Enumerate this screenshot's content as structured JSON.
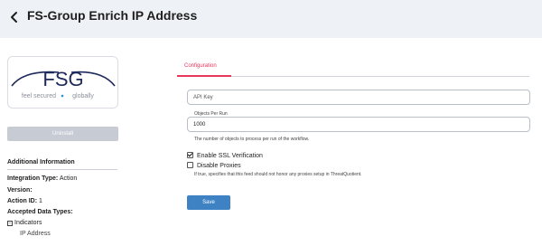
{
  "header": {
    "title": "FS-Group Enrich IP Address",
    "back_icon": "chevron-left-icon"
  },
  "sidebar": {
    "logo": {
      "mark": "FSG",
      "tagline_left": "feel secured",
      "tagline_right": "globally",
      "brand_color": "#1f2a5c",
      "dot_color": "#2a8fd6"
    },
    "uninstall_label": "Uninstall",
    "additional_info": {
      "heading": "Additional Information",
      "integration_type_label": "Integration Type:",
      "integration_type_value": "Action",
      "version_label": "Version:",
      "version_value": "",
      "action_id_label": "Action ID:",
      "action_id_value": "1",
      "accepted_types_label": "Accepted Data Types:",
      "indicators_label": "Indicators",
      "indicator_items": [
        "IP Address"
      ]
    }
  },
  "main": {
    "tabs": [
      {
        "label": "Configuration",
        "active": true
      }
    ],
    "api_key": {
      "placeholder": "API Key",
      "value": ""
    },
    "objects_per_run": {
      "label": "Objects Per Run",
      "value": "1000",
      "help": "The number of objects to process per run of the workflow."
    },
    "enable_ssl": {
      "label": "Enable SSL Verification",
      "checked": true
    },
    "disable_proxies": {
      "label": "Disable Proxies",
      "checked": false,
      "help": "If true, specifies that this feed should not honor any proxies setup in ThreatQuotient."
    },
    "save_label": "Save"
  },
  "colors": {
    "accent": "#e8365d",
    "primary_button": "#3e82c4",
    "header_bg": "#eef1f5",
    "disabled_button": "#c7ccd4"
  }
}
